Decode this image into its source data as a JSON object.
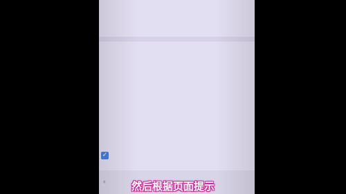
{
  "intro": {
    "line1": "",
    "line2": "",
    "learn_more": ""
  },
  "section_caption": "",
  "permission": {
    "heading": "",
    "text": ""
  },
  "statement": {
    "heading": "",
    "text": ""
  },
  "agree": {
    "checked": true,
    "label": ""
  },
  "nav": {
    "back_label": "",
    "next_label": ""
  },
  "caption": "然后根据页面提示",
  "colors": {
    "screen_bg": "#e3dff2",
    "link": "#3a68c8",
    "checkbox": "#4a7de0",
    "caption_outline": "#d3239a"
  }
}
